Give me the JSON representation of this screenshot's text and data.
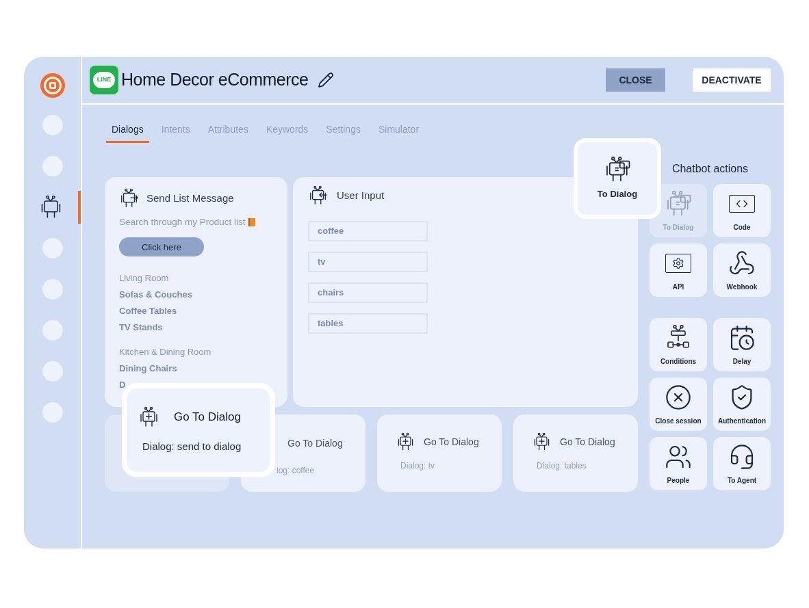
{
  "header": {
    "logo_text": "LINE",
    "title": "Home Decor eCommerce",
    "buttons": [
      {
        "label": "CLOSE",
        "kind": "primary"
      },
      {
        "label": "DEACTIVATE",
        "kind": "secondary"
      }
    ]
  },
  "sidebar": {
    "items": [
      {
        "kind": "dot",
        "selected": false
      },
      {
        "kind": "dot",
        "selected": false
      },
      {
        "kind": "robot",
        "selected": true
      },
      {
        "kind": "dot",
        "selected": false
      },
      {
        "kind": "dot",
        "selected": false
      },
      {
        "kind": "dot",
        "selected": false
      },
      {
        "kind": "dot",
        "selected": false
      },
      {
        "kind": "dot",
        "selected": false
      }
    ]
  },
  "tabs": [
    {
      "label": "Dialogs",
      "selected": true
    },
    {
      "label": "Intents",
      "selected": false
    },
    {
      "label": "Attributes",
      "selected": false
    },
    {
      "label": "Keywords",
      "selected": false
    },
    {
      "label": "Settings",
      "selected": false
    },
    {
      "label": "Simulator",
      "selected": false
    }
  ],
  "send_list": {
    "title": "Send List Message",
    "text": "Search through my Product list",
    "button": "Click here",
    "sections": [
      {
        "heading": "Living Room",
        "items": [
          "Sofas & Couches",
          "Coffee Tables",
          "TV Stands"
        ]
      },
      {
        "heading": "Kitchen & Dining Room",
        "items": [
          "Dining Chairs",
          "D"
        ]
      }
    ]
  },
  "user_input": {
    "title": "User Input",
    "options": [
      "coffee",
      "tv",
      "chairs",
      "tables"
    ]
  },
  "dialog_cards": [
    {
      "kind": "placeholder"
    },
    {
      "kind": "partial",
      "title": "Go To Dialog",
      "subtitle": "log: coffee"
    },
    {
      "kind": "full",
      "title": "Go To Dialog",
      "subtitle": "Dialog: tv"
    },
    {
      "kind": "full",
      "title": "Go To Dialog",
      "subtitle": "Dialog: tables"
    }
  ],
  "dragged_card": {
    "title": "Go To Dialog",
    "subtitle": "Dialog: send to dialog"
  },
  "actions": {
    "title": "Chatbot actions",
    "groups": [
      [
        {
          "label": "To Dialog",
          "kind": "dialog",
          "disabled": true
        },
        {
          "label": "Code",
          "kind": "code",
          "disabled": false
        },
        {
          "label": "API",
          "kind": "api",
          "disabled": false
        },
        {
          "label": "Webhook",
          "kind": "webhook",
          "disabled": false
        }
      ],
      [
        {
          "label": "Conditions",
          "kind": "conditions",
          "disabled": false
        },
        {
          "label": "Delay",
          "kind": "delay",
          "disabled": false
        },
        {
          "label": "Close session",
          "kind": "close",
          "disabled": false
        },
        {
          "label": "Authentication",
          "kind": "auth",
          "disabled": false
        },
        {
          "label": "People",
          "kind": "people",
          "disabled": false
        },
        {
          "label": "To Agent",
          "kind": "agent",
          "disabled": false
        }
      ]
    ]
  },
  "dragged_action": {
    "label": "To Dialog",
    "kind": "dialog"
  }
}
